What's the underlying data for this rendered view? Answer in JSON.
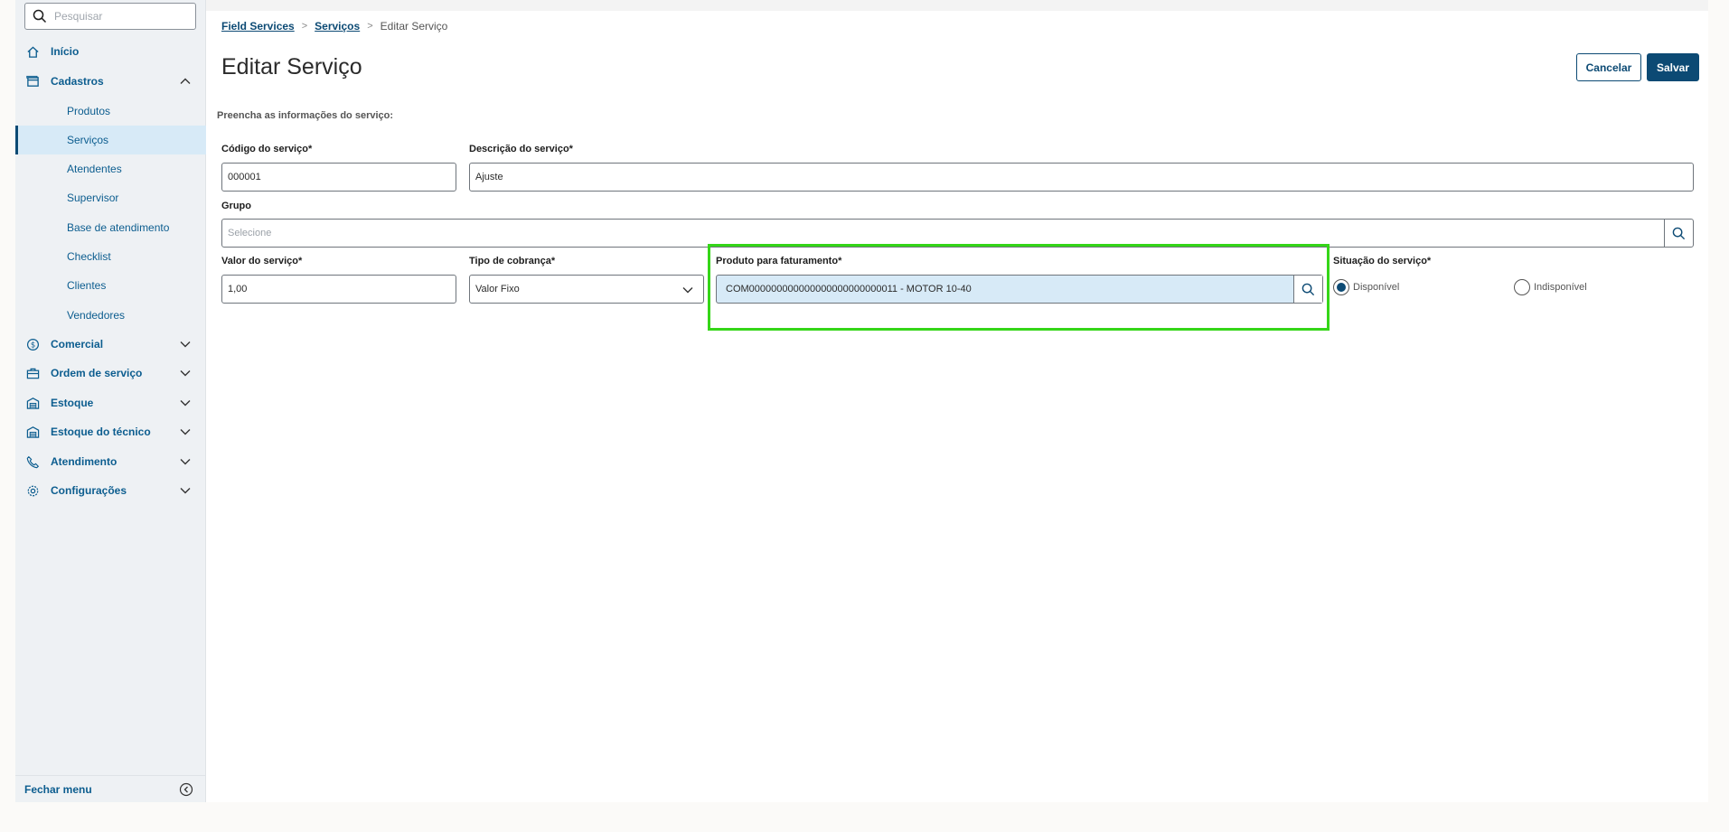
{
  "search": {
    "placeholder": "Pesquisar"
  },
  "sidebar": {
    "items": [
      {
        "label": "Início",
        "icon": "home-icon"
      },
      {
        "label": "Cadastros",
        "icon": "window-icon",
        "expanded": true
      },
      {
        "label": "Comercial",
        "icon": "dollar-circle-icon"
      },
      {
        "label": "Ordem de serviço",
        "icon": "briefcase-icon"
      },
      {
        "label": "Estoque",
        "icon": "warehouse-icon"
      },
      {
        "label": "Estoque do técnico",
        "icon": "warehouse-icon"
      },
      {
        "label": "Atendimento",
        "icon": "phone-icon"
      },
      {
        "label": "Configurações",
        "icon": "gear-icon"
      }
    ],
    "cadastros_sub": [
      {
        "label": "Produtos"
      },
      {
        "label": "Serviços",
        "active": true
      },
      {
        "label": "Atendentes"
      },
      {
        "label": "Supervisor"
      },
      {
        "label": "Base de atendimento"
      },
      {
        "label": "Checklist"
      },
      {
        "label": "Clientes"
      },
      {
        "label": "Vendedores"
      }
    ],
    "close_menu": "Fechar menu"
  },
  "breadcrumb": {
    "items": [
      "Field Services",
      "Serviços",
      "Editar Serviço"
    ]
  },
  "page": {
    "title": "Editar Serviço",
    "instructions": "Preencha as informações do serviço:"
  },
  "actions": {
    "cancel": "Cancelar",
    "save": "Salvar"
  },
  "form": {
    "codigo": {
      "label": "Código do serviço*",
      "value": "000001"
    },
    "descricao": {
      "label": "Descrição do serviço*",
      "value": "Ajuste"
    },
    "grupo": {
      "label": "Grupo",
      "placeholder": "Selecione"
    },
    "valor": {
      "label": "Valor do serviço*",
      "value": "1,00"
    },
    "tipo": {
      "label": "Tipo de cobrança*",
      "value": "Valor Fixo"
    },
    "produto": {
      "label": "Produto para faturamento*",
      "value": "COM000000000000000000000000011 - MOTOR 10-40"
    },
    "situacao": {
      "label": "Situação do serviço*",
      "options": [
        "Disponível",
        "Indisponível"
      ],
      "selected": "Disponível"
    }
  },
  "colors": {
    "brand": "#0c4a74",
    "link": "#0c5d8f",
    "highlight": "#35d618",
    "active_bg": "#d7eaf7"
  }
}
